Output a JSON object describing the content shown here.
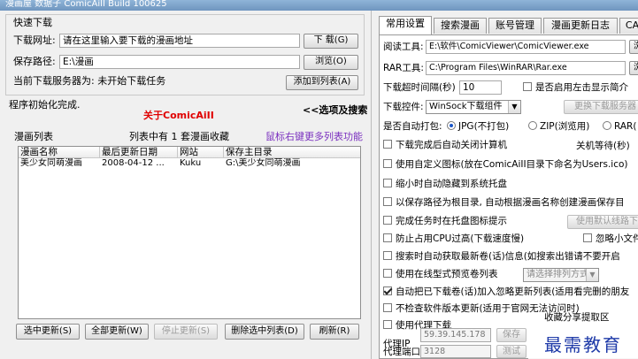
{
  "window": {
    "title": "漫画屋  数据子 ComicAiII Build 100625"
  },
  "quick_download": {
    "group_title": "快速下载",
    "url_label": "下载网址:",
    "url_value": "请在这里输入要下载的漫画地址",
    "download_btn": "下 载(G)",
    "save_label": "保存路径:",
    "save_value": "E:\\漫画",
    "browse_btn": "浏览(O)",
    "server_label": "当前下载服务器为: 未开始下载任务",
    "add_list_btn": "添加到列表(A)"
  },
  "status": {
    "init_text": "程序初始化完成.",
    "about_link": "关于ComicAiII",
    "toggle_link": "<<选项及搜索"
  },
  "comic_list": {
    "title": "漫画列表",
    "count_text": "列表中有  1  套漫画收藏",
    "hint_text": "鼠标右键更多列表功能",
    "columns": [
      "漫画名称",
      "最后更新日期",
      "网站",
      "保存主目录"
    ],
    "rows": [
      [
        "美少女同萌漫画",
        "2008-04-12 ...",
        "Kuku",
        "G:\\美少女同萌漫画"
      ]
    ]
  },
  "bottom_buttons": {
    "update_selected": "选中更新(S)",
    "update_all": "全部更新(W)",
    "stop_update": "停止更新(S)",
    "delete_selected": "删除选中列表(D)",
    "refresh": "刷新(R)"
  },
  "tabs": [
    "常用设置",
    "搜索漫画",
    "账号管理",
    "漫画更新日志",
    "CA设"
  ],
  "settings": {
    "reader_label": "阅读工具:",
    "reader_value": "E:\\软件\\ComicViewer\\ComicViewer.exe",
    "reader_btn": "浏",
    "rar_label": "RAR工具:",
    "rar_value": "C:\\Program Files\\WinRAR\\Rar.exe",
    "rar_btn": "浏",
    "timeout_label": "下载超时间隔(秒)",
    "timeout_value": "10",
    "show_intro": "是否启用左击显示简介",
    "control_label": "下载控件:",
    "control_value": "WinSock下载组件",
    "switch_server_btn": "更换下载服务器",
    "pack_label": "是否自动打包:",
    "pack_opt1": "JPG(不打包)",
    "pack_opt2": "ZIP(浏览用)",
    "pack_opt3": "RAR(",
    "opt_shutdown": "下载完成后自动关闭计算机",
    "shutdown_wait": "关机等待(秒)",
    "opt_custom_icon": "使用自定义图标(放在ComicAiII目录下命名为Users.ico)",
    "opt_tray": "缩小时自动隐藏到系统托盘",
    "opt_root_path": "以保存路径为根目录, 自动根据漫画名称创建漫画保存目",
    "default_path_btn": "使用默认线路下",
    "opt_tray_notify": "完成任务时在托盘图标提示",
    "opt_cpu": "防止占用CPU过高(下载速度慢)",
    "opt_ignore_small": "忽略小文件验",
    "opt_auto_fetch": "搜索时自动获取最新卷(话)信息(如搜索出错请不要开启",
    "opt_online_preview": "使用在线型式预览卷列表",
    "sort_select": "请选择排列方式",
    "opt_auto_ignore": "自动把已下载卷(话)加入忽略更新列表(适用看完删的朋友",
    "opt_no_version": "不检查软件版本更新(适用于官网无法访问时)",
    "opt_proxy": "使用代理下载",
    "share_label": "收藏分享提取区",
    "proxy_ip_label": "代理IP",
    "proxy_ip_value": "59.39.145.178",
    "save_btn": "保存",
    "proxy_port_label": "代理端口",
    "proxy_port_value": "3128",
    "test_btn": "测试"
  },
  "watermark": "最需教育"
}
